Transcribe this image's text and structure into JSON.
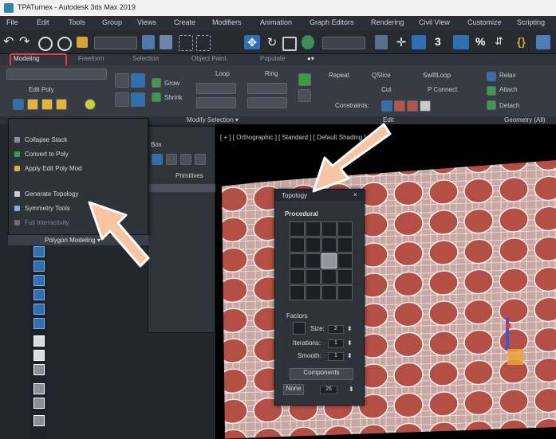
{
  "window": {
    "title": "TPATurnex - Autodesk 3ds Max 2019"
  },
  "menu": [
    "File",
    "Edit",
    "Tools",
    "Group",
    "Views",
    "Create",
    "Modifiers",
    "Animation",
    "Graph Editors",
    "Rendering",
    "Civil View",
    "Customize",
    "Scripting"
  ],
  "ribbon_tabs": {
    "modeling": "Modeling",
    "others": [
      "Freeform",
      "Selection",
      "Object Paint",
      "Populate"
    ]
  },
  "ribbon": {
    "edit_poly": "Edit Poly",
    "grow": "Grow",
    "shrink": "Shrink",
    "loop": "Loop",
    "ring": "Ring",
    "repeat": "Repeat",
    "quickslice": "QSlice",
    "swiftloop": "SwiftLoop",
    "cut": "Cut",
    "pconnect": "P Connect",
    "constraints": "Constraints:",
    "relax": "Relax",
    "attach": "Attach",
    "detach": "Detach",
    "modify_selection": "Modify Selection ▾",
    "edit_label": "Edit",
    "geometry_all": "Geometry (All)"
  },
  "dropdown": {
    "items": [
      "Collapse Stack",
      "Convert to Poly",
      "Apply Edit Poly Mod",
      "Generate Topology",
      "Symmetry Tools",
      "Full Interactivity"
    ],
    "footer": "Polygon Modeling ▾"
  },
  "command_panel": {
    "modifier_label": "Box",
    "modifier_list": "Primitives"
  },
  "viewport": {
    "label": "[ + ] [ Orthographic ] [ Standard ] [ Default Shading ]"
  },
  "topology": {
    "title": "Topology",
    "section": "Procedural",
    "factors_label": "Factors",
    "size_label": "Size:",
    "size_val": "2",
    "iterations_label": "Iterations:",
    "iterations_val": "1",
    "smooth_label": "Smooth:",
    "smooth_val": "1",
    "components_btn": "Components",
    "bottom_left": "None",
    "bottom_val": "26"
  },
  "colors": {
    "accent_red": "#e23b3b",
    "surface": "#b9524a",
    "dialog": "#2e333a"
  }
}
